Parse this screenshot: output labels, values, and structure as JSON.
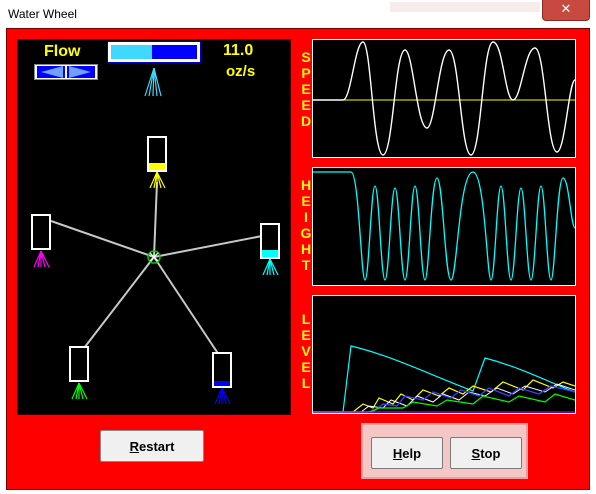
{
  "window": {
    "title": "Water Wheel",
    "close_glyph": "✕"
  },
  "flow": {
    "label": "Flow",
    "value": "11.0",
    "unit": "oz/s",
    "level": 0.48,
    "fill_color": "#3fd8ff"
  },
  "graphs": {
    "speed_label": "SPEED",
    "height_label": "HEIGHT",
    "level_label": "LEVEL"
  },
  "buttons": {
    "restart": "Restart",
    "help": "Help",
    "stop": "Stop"
  },
  "buckets": [
    {
      "color": "#ffff00",
      "level": 0.3
    },
    {
      "color": "#00ffff",
      "level": 0.25
    },
    {
      "color": "#0000ff",
      "level": 0.15
    },
    {
      "color": "#00ff00",
      "level": 0.0
    },
    {
      "color": "#ff00ff",
      "level": 0.0
    }
  ],
  "colors": {
    "background": "#ff0000",
    "label": "#ffff00",
    "speed_trace": "#ffffff",
    "height_trace": "#00ffff",
    "zero_line": "#ffff00"
  },
  "icons": {
    "flow_left": "left-triangle-icon",
    "flow_right": "right-triangle-icon",
    "hub": "circle-icon"
  }
}
